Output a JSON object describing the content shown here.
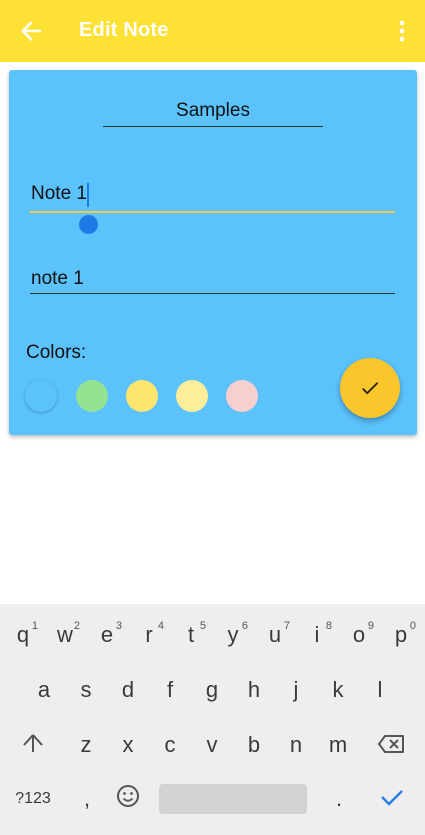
{
  "app_bar": {
    "title": "Edit Note",
    "back_icon": "arrow-back-icon",
    "menu_icon": "more-vert-icon",
    "background": "#FDE135"
  },
  "note": {
    "category": "Samples",
    "title_value": "Note 1",
    "body_value": "note 1",
    "card_color": "#5BC2FC"
  },
  "colors": {
    "label": "Colors:",
    "swatches": [
      "#5BC2FC",
      "#92E38F",
      "#FDE670",
      "#FFEE99",
      "#F8CFCF"
    ]
  },
  "save_fab": {
    "icon": "check-icon",
    "color": "#FBC52C"
  },
  "keyboard": {
    "row1": [
      {
        "ch": "q",
        "sup": "1"
      },
      {
        "ch": "w",
        "sup": "2"
      },
      {
        "ch": "e",
        "sup": "3"
      },
      {
        "ch": "r",
        "sup": "4"
      },
      {
        "ch": "t",
        "sup": "5"
      },
      {
        "ch": "y",
        "sup": "6"
      },
      {
        "ch": "u",
        "sup": "7"
      },
      {
        "ch": "i",
        "sup": "8"
      },
      {
        "ch": "o",
        "sup": "9"
      },
      {
        "ch": "p",
        "sup": "0"
      }
    ],
    "row2": [
      "a",
      "s",
      "d",
      "f",
      "g",
      "h",
      "j",
      "k",
      "l"
    ],
    "row3": [
      "z",
      "x",
      "c",
      "v",
      "b",
      "n",
      "m"
    ],
    "symbols_label": "?123",
    "comma": ",",
    "period": ".",
    "shift_icon": "shift-arrow-icon",
    "backspace_icon": "backspace-icon",
    "emoji_icon": "emoji-icon",
    "enter_icon": "check-icon"
  }
}
